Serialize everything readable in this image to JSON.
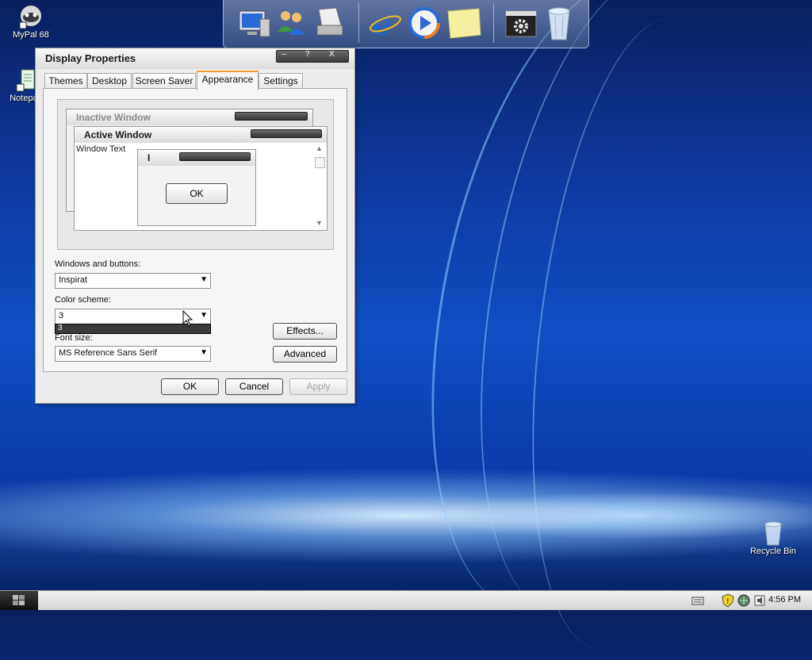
{
  "desktop": {
    "icons": [
      {
        "label": "MyPal 68"
      },
      {
        "label": "Notepad"
      },
      {
        "label": "Recycle Bin"
      }
    ]
  },
  "dock": {
    "items": [
      "my-computer-icon",
      "users-icon",
      "printer-icon",
      "internet-explorer-icon",
      "media-player-icon",
      "sticky-notes-icon",
      "control-panel-icon",
      "recycle-bin-icon"
    ]
  },
  "dialog": {
    "title": "Display Properties",
    "title_buttons": [
      "?",
      "X"
    ],
    "tabs": [
      "Themes",
      "Desktop",
      "Screen Saver",
      "Appearance",
      "Settings"
    ],
    "active_tab": "Appearance",
    "preview": {
      "inactive_title": "Inactive Window",
      "active_title": "Active Window",
      "window_text": "Window Text",
      "msgbox_title": "I",
      "msgbox_ok": "OK"
    },
    "windows_buttons_label": "Windows and buttons:",
    "windows_buttons_value": "Inspirat",
    "color_scheme_label": "Color scheme:",
    "color_scheme_value": "3",
    "color_scheme_option": "3",
    "font_size_label": "Font size:",
    "font_size_value": "MS Reference Sans Serif",
    "effects_label": "Effects...",
    "advanced_label": "Advanced",
    "ok_label": "OK",
    "cancel_label": "Cancel",
    "apply_label": "Apply"
  },
  "taskbar": {
    "clock": "4:56 PM",
    "tray_icons": [
      "keyboard-icon",
      "security-shield-icon",
      "network-icon",
      "volume-icon"
    ]
  },
  "colors": {
    "accent_tab": "#f0a030",
    "selection": "#3a3a3a",
    "desktop_blue": "#0f4fc4"
  }
}
